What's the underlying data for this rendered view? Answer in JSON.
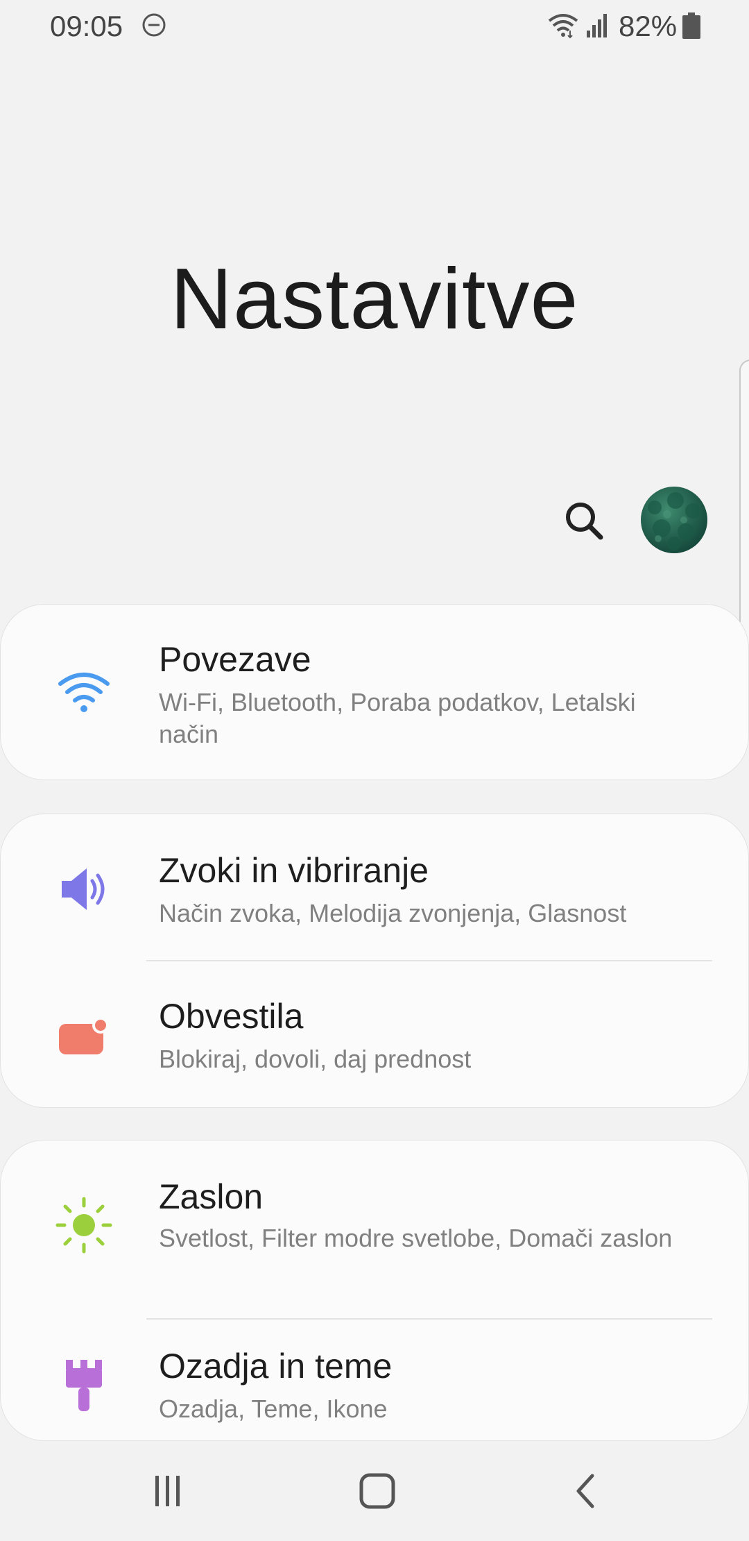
{
  "status_bar": {
    "time": "09:05",
    "battery": "82%"
  },
  "header": {
    "title": "Nastavitve"
  },
  "icons": {
    "search": "search-icon",
    "dnd": "do-not-disturb-icon",
    "wifi_status": "wifi-icon",
    "signal": "signal-icon",
    "battery": "battery-icon"
  },
  "colors": {
    "wifi": "#4a9bf0",
    "sound": "#7d77e8",
    "notifications": "#f07c6c",
    "display": "#9ccf3c",
    "wallpapers": "#b86fd8"
  },
  "settings": [
    {
      "title": "Povezave",
      "subtitle": "Wi-Fi, Bluetooth, Poraba podatkov, Letalski način",
      "icon": "wifi-icon"
    },
    {
      "title": "Zvoki in vibriranje",
      "subtitle": "Način zvoka, Melodija zvonjenja, Glasnost",
      "icon": "speaker-icon"
    },
    {
      "title": "Obvestila",
      "subtitle": "Blokiraj, dovoli, daj prednost",
      "icon": "notification-icon"
    },
    {
      "title": "Zaslon",
      "subtitle": "Svetlost, Filter modre svetlobe, Domači zaslon",
      "icon": "brightness-icon"
    },
    {
      "title": "Ozadja in teme",
      "subtitle": "Ozadja, Teme, Ikone",
      "icon": "paint-brush-icon"
    }
  ],
  "nav": {
    "recents": "recents-icon",
    "home": "home-icon",
    "back": "back-icon"
  }
}
